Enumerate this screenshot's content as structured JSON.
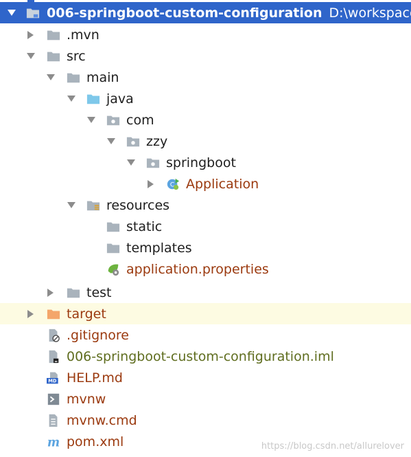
{
  "tree": {
    "root": {
      "label": "006-springboot-custom-configuration",
      "path": "D:\\workspace\\"
    },
    "items": [
      {
        "label": ".mvn"
      },
      {
        "label": "src"
      },
      {
        "label": "main"
      },
      {
        "label": "java"
      },
      {
        "label": "com"
      },
      {
        "label": "zzy"
      },
      {
        "label": "springboot"
      },
      {
        "label": "Application"
      },
      {
        "label": "resources"
      },
      {
        "label": "static"
      },
      {
        "label": "templates"
      },
      {
        "label": "application.properties"
      },
      {
        "label": "test"
      },
      {
        "label": "target"
      },
      {
        "label": ".gitignore"
      },
      {
        "label": "006-springboot-custom-configuration.iml"
      },
      {
        "label": "HELP.md"
      },
      {
        "label": "mvnw"
      },
      {
        "label": "mvnw.cmd"
      },
      {
        "label": "pom.xml"
      }
    ]
  },
  "watermark": "https://blog.csdn.net/allurelover",
  "colors": {
    "selection": "#2f65ca",
    "highlight_row": "#fdfbe2",
    "folder": "#a9b3bc",
    "source_folder": "#7ec8ea",
    "excluded_folder": "#f4a66a"
  }
}
